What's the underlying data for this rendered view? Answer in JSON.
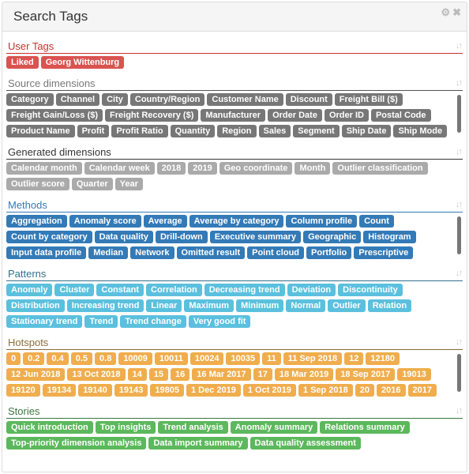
{
  "header": {
    "title": "Search Tags",
    "icons": [
      "gear-icon",
      "close-icon"
    ]
  },
  "sections": [
    {
      "title": "User Tags",
      "heading_color": "#c9302c",
      "line_color": "#c9302c",
      "tag_color": "#d9534f",
      "scroll": false,
      "tags": [
        "Liked",
        "Georg Wittenburg"
      ]
    },
    {
      "title": "Source dimensions",
      "heading_color": "#777777",
      "line_color": "#555555",
      "tag_color": "#777777",
      "scroll": true,
      "tags": [
        "Category",
        "Channel",
        "City",
        "Country/Region",
        "Customer Name",
        "Discount",
        "Freight Bill ($)",
        "Freight Gain/Loss ($)",
        "Freight Recovery ($)",
        "Manufacturer",
        "Order Date",
        "Order ID",
        "Postal Code",
        "Product Name",
        "Profit",
        "Profit Ratio",
        "Quantity",
        "Region",
        "Sales",
        "Segment",
        "Ship Date",
        "Ship Mode"
      ]
    },
    {
      "title": "Generated dimensions",
      "heading_color": "#333333",
      "line_color": "#333333",
      "tag_color": "#aaaaaa",
      "scroll": false,
      "tags": [
        "Calendar month",
        "Calendar week",
        "2018",
        "2019",
        "Geo coordinate",
        "Month",
        "Outlier classification",
        "Outlier score",
        "Quarter",
        "Year"
      ]
    },
    {
      "title": "Methods",
      "heading_color": "#337ab7",
      "line_color": "#337ab7",
      "tag_color": "#337ab7",
      "scroll": true,
      "tags": [
        "Aggregation",
        "Anomaly score",
        "Average",
        "Average by category",
        "Column profile",
        "Count",
        "Count by category",
        "Data quality",
        "Drill-down",
        "Executive summary",
        "Geographic",
        "Histogram",
        "Input data profile",
        "Median",
        "Network",
        "Omitted result",
        "Point cloud",
        "Portfolio",
        "Prescriptive"
      ]
    },
    {
      "title": "Patterns",
      "heading_color": "#31708f",
      "line_color": "#31708f",
      "tag_color": "#5bc0de",
      "scroll": false,
      "tags": [
        "Anomaly",
        "Cluster",
        "Constant",
        "Correlation",
        "Decreasing trend",
        "Deviation",
        "Discontinuity",
        "Distribution",
        "Increasing trend",
        "Linear",
        "Maximum",
        "Minimum",
        "Normal",
        "Outlier",
        "Relation",
        "Stationary trend",
        "Trend",
        "Trend change",
        "Very good fit"
      ]
    },
    {
      "title": "Hotspots",
      "heading_color": "#8a6d3b",
      "line_color": "#8a6d3b",
      "tag_color": "#f0ad4e",
      "scroll": true,
      "tags": [
        "0",
        "0.2",
        "0.4",
        "0.5",
        "0.8",
        "10009",
        "10011",
        "10024",
        "10035",
        "11",
        "11 Sep 2018",
        "12",
        "12180",
        "12 Jun 2018",
        "13 Oct 2018",
        "14",
        "15",
        "16",
        "16 Mar 2017",
        "17",
        "18 Mar 2019",
        "18 Sep 2017",
        "19013",
        "19120",
        "19134",
        "19140",
        "19143",
        "19805",
        "1 Dec 2019",
        "1 Oct 2019",
        "1 Sep 2018",
        "20",
        "2016",
        "2017"
      ]
    },
    {
      "title": "Stories",
      "heading_color": "#3c763d",
      "line_color": "#3c763d",
      "tag_color": "#5cb85c",
      "scroll": false,
      "tags": [
        "Quick introduction",
        "Top insights",
        "Trend analysis",
        "Anomaly summary",
        "Relations summary",
        "Top-priority dimension analysis",
        "Data import summary",
        "Data quality assessment"
      ]
    }
  ]
}
